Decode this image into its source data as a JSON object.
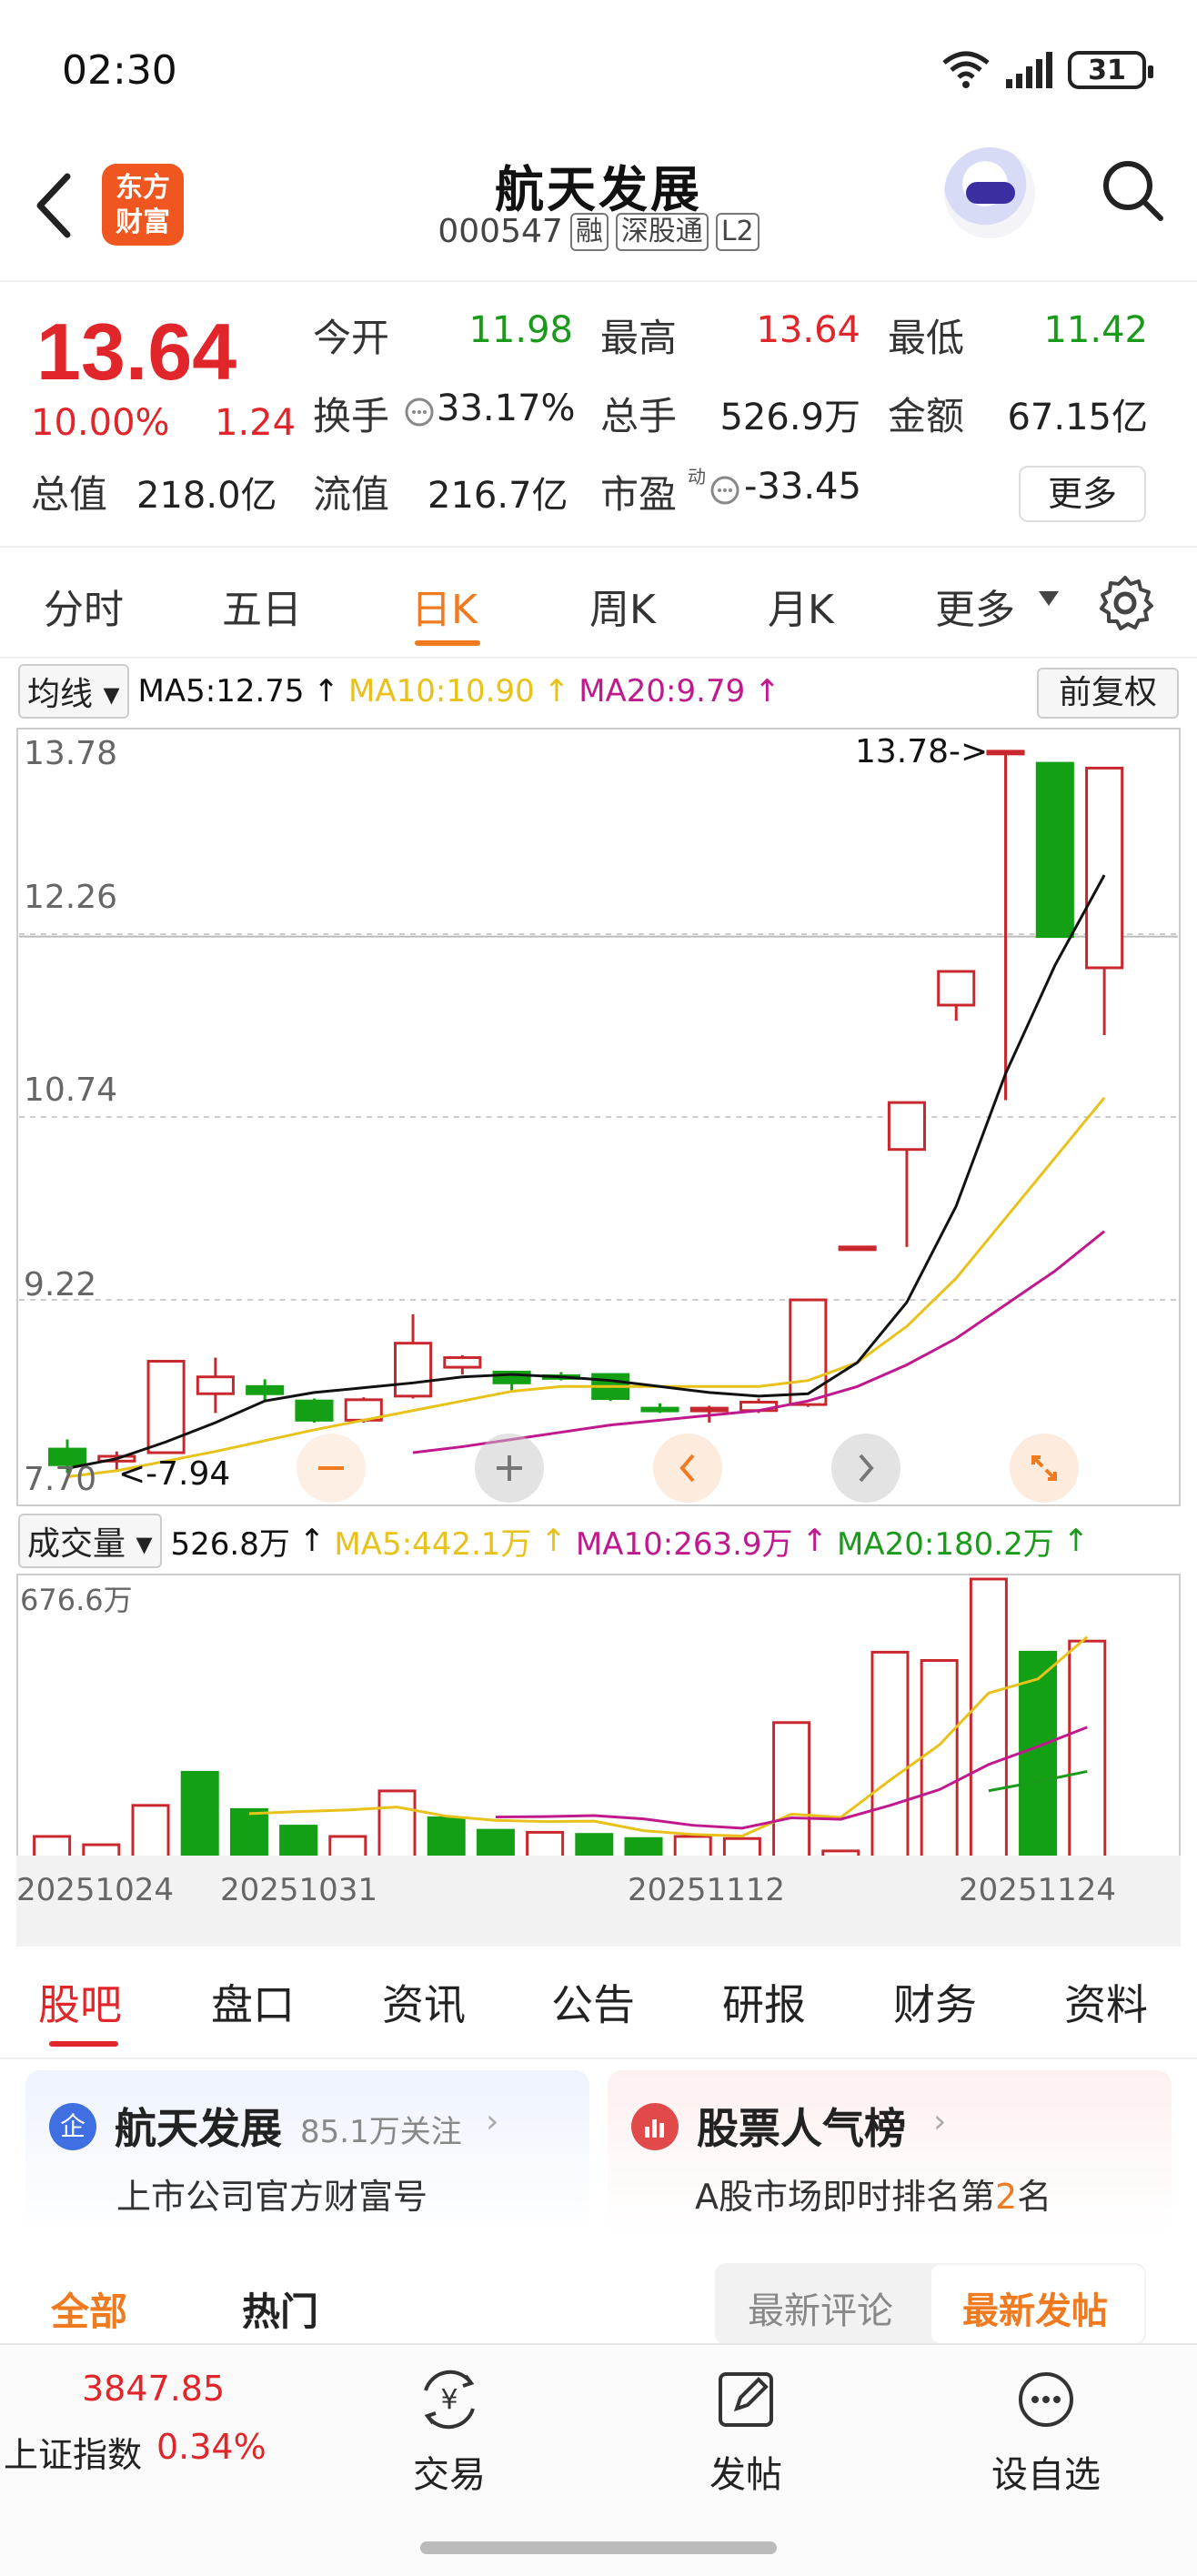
{
  "status_bar": {
    "time": "02:30",
    "battery": "31"
  },
  "header": {
    "logo_line1": "东方",
    "logo_line2": "财富",
    "stock_name": "航天发展",
    "stock_code": "000547",
    "tags": [
      "融",
      "深股通",
      "L2"
    ]
  },
  "quote": {
    "price": "13.64",
    "change_pct": "10.00%",
    "change_amt": "1.24",
    "rows": [
      [
        {
          "label": "今开",
          "value": "11.98",
          "color": "green"
        },
        {
          "label": "最高",
          "value": "13.64",
          "color": "red"
        },
        {
          "label": "最低",
          "value": "11.42",
          "color": "green"
        }
      ],
      [
        {
          "label": "换手",
          "value": "33.17%",
          "color": "black"
        },
        {
          "label": "总手",
          "value": "526.9万",
          "color": "black"
        },
        {
          "label": "金额",
          "value": "67.15亿",
          "color": "black"
        }
      ],
      [
        {
          "label": "总值",
          "value": "218.0亿",
          "color": "black"
        },
        {
          "label": "流值",
          "value": "216.7亿",
          "color": "black"
        },
        {
          "label": "市盈",
          "value": "-33.45",
          "color": "black"
        }
      ]
    ],
    "pe_superscript": "动",
    "more_label": "更多"
  },
  "chart_tabs": {
    "items": [
      "分时",
      "五日",
      "日K",
      "周K",
      "月K",
      "更多"
    ],
    "active": "日K"
  },
  "ma_legend": {
    "selector": "均线",
    "ma5": "MA5:12.75",
    "ma10": "MA10:10.90",
    "ma20": "MA20:9.79",
    "fuquan": "前复权"
  },
  "kline": {
    "y_labels": [
      "13.78",
      "12.26",
      "10.74",
      "9.22",
      "7.70"
    ],
    "high_annot": "13.78->",
    "low_annot": "<-7.94"
  },
  "vol_legend": {
    "selector": "成交量",
    "vol": "526.8万",
    "ma5": "MA5:442.1万",
    "ma10": "MA10:263.9万",
    "ma20": "MA20:180.2万",
    "max": "676.6万"
  },
  "dates": [
    "20251024",
    "20251031",
    "20251112",
    "20251124"
  ],
  "chart_data": {
    "type": "candlestick",
    "title": "",
    "ylim": [
      7.7,
      13.78
    ],
    "candles": [
      {
        "o": 7.98,
        "c": 7.85,
        "h": 8.06,
        "l": 7.78
      },
      {
        "o": 7.88,
        "c": 7.92,
        "h": 7.96,
        "l": 7.8
      },
      {
        "o": 7.95,
        "c": 8.71,
        "h": 8.71,
        "l": 7.94
      },
      {
        "o": 8.44,
        "c": 8.58,
        "h": 8.74,
        "l": 8.28
      },
      {
        "o": 8.5,
        "c": 8.44,
        "h": 8.56,
        "l": 8.38
      },
      {
        "o": 8.38,
        "c": 8.22,
        "h": 8.4,
        "l": 8.2
      },
      {
        "o": 8.22,
        "c": 8.39,
        "h": 8.41,
        "l": 8.2
      },
      {
        "o": 8.42,
        "c": 8.86,
        "h": 9.1,
        "l": 8.4
      },
      {
        "o": 8.66,
        "c": 8.74,
        "h": 8.76,
        "l": 8.6
      },
      {
        "o": 8.62,
        "c": 8.53,
        "h": 8.63,
        "l": 8.46
      },
      {
        "o": 8.59,
        "c": 8.58,
        "h": 8.62,
        "l": 8.55
      },
      {
        "o": 8.6,
        "c": 8.4,
        "h": 8.6,
        "l": 8.38
      },
      {
        "o": 8.32,
        "c": 8.3,
        "h": 8.36,
        "l": 8.28
      },
      {
        "o": 8.3,
        "c": 8.32,
        "h": 8.34,
        "l": 8.2
      },
      {
        "o": 8.3,
        "c": 8.37,
        "h": 8.4,
        "l": 8.28
      },
      {
        "o": 8.35,
        "c": 9.22,
        "h": 9.22,
        "l": 8.33
      },
      {
        "o": 9.66,
        "c": 9.66,
        "h": 9.66,
        "l": 9.66
      },
      {
        "o": 10.47,
        "c": 10.86,
        "h": 10.86,
        "l": 9.66
      },
      {
        "o": 11.67,
        "c": 11.95,
        "h": 11.95,
        "l": 11.54
      },
      {
        "o": 13.78,
        "c": 13.78,
        "h": 13.78,
        "l": 10.88
      },
      {
        "o": 13.68,
        "c": 12.24,
        "h": 13.68,
        "l": 12.24
      },
      {
        "o": 11.98,
        "c": 13.64,
        "h": 13.64,
        "l": 11.42
      }
    ],
    "ma5": [
      7.82,
      7.9,
      8.04,
      8.2,
      8.38,
      8.45,
      8.49,
      8.53,
      8.58,
      8.6,
      8.58,
      8.55,
      8.5,
      8.45,
      8.42,
      8.44,
      8.7,
      9.2,
      10.0,
      11.1,
      12.0,
      12.75
    ],
    "ma10": [
      7.75,
      7.8,
      7.88,
      7.96,
      8.05,
      8.14,
      8.22,
      8.3,
      8.38,
      8.46,
      8.5,
      8.5,
      8.5,
      8.5,
      8.5,
      8.55,
      8.7,
      9.0,
      9.4,
      9.9,
      10.4,
      10.9
    ],
    "ma20": [
      null,
      null,
      null,
      null,
      null,
      null,
      null,
      7.95,
      8.0,
      8.06,
      8.12,
      8.18,
      8.22,
      8.26,
      8.3,
      8.38,
      8.5,
      8.68,
      8.9,
      9.18,
      9.46,
      9.79
    ],
    "volumes": [
      55,
      35,
      130,
      210,
      120,
      80,
      55,
      165,
      100,
      70,
      65,
      60,
      50,
      55,
      50,
      330,
      20,
      500,
      480,
      676.6,
      500,
      526.8
    ],
    "vol_colors": [
      "r",
      "r",
      "r",
      "g",
      "g",
      "g",
      "r",
      "r",
      "g",
      "g",
      "r",
      "g",
      "g",
      "r",
      "r",
      "r",
      "r",
      "r",
      "r",
      "r",
      "g",
      "r"
    ]
  },
  "lower_tabs": {
    "items": [
      "股吧",
      "盘口",
      "资讯",
      "公告",
      "研报",
      "财务",
      "资料"
    ],
    "active": "股吧"
  },
  "cards": {
    "company": {
      "icon": "企",
      "title": "航天发展",
      "followers": "85.1万关注",
      "sub": "上市公司官方财富号"
    },
    "rank": {
      "title": "股票人气榜",
      "sub_prefix": "A股市场即时排名第",
      "rank": "2",
      "sub_suffix": "名"
    }
  },
  "filters": {
    "all": "全部",
    "hot": "热门",
    "new_comment": "最新评论",
    "new_post": "最新发帖"
  },
  "bottom_bar": {
    "index_value": "3847.85",
    "index_name": "上证指数",
    "index_pct": "0.34%",
    "items": [
      "交易",
      "发帖",
      "设自选"
    ]
  }
}
